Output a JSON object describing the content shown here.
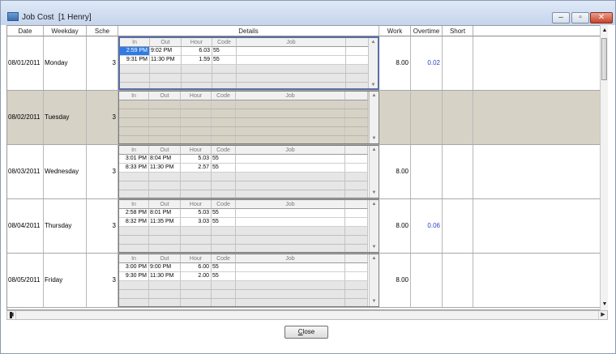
{
  "window": {
    "title": "Job Cost  [1 Henry]",
    "minimize_glyph": "–",
    "maximize_glyph": "▫",
    "close_glyph": "✕"
  },
  "columns": {
    "date": "Date",
    "weekday": "Weekday",
    "sche": "Sche",
    "details": "Details",
    "work": "Work",
    "overtime": "Overtime",
    "short": "Short"
  },
  "detail_columns": {
    "in": "In",
    "out": "Out",
    "hour": "Hour",
    "code": "Code",
    "job": "Job"
  },
  "rows": [
    {
      "date": "08/01/2011",
      "weekday": "Monday",
      "sche": "3",
      "work": "8.00",
      "overtime": "0.02",
      "short": "",
      "entries": [
        {
          "in": "2:59 PM",
          "out": "9:02 PM",
          "hour": "6.03",
          "code": "55",
          "job": ""
        },
        {
          "in": "9:31 PM",
          "out": "11:30 PM",
          "hour": "1.59",
          "code": "55",
          "job": ""
        }
      ]
    },
    {
      "date": "08/02/2011",
      "weekday": "Tuesday",
      "sche": "3",
      "work": "",
      "overtime": "",
      "short": "",
      "entries": []
    },
    {
      "date": "08/03/2011",
      "weekday": "Wednesday",
      "sche": "3",
      "work": "8.00",
      "overtime": "",
      "short": "",
      "entries": [
        {
          "in": "3:01 PM",
          "out": "8:04 PM",
          "hour": "5.03",
          "code": "55",
          "job": ""
        },
        {
          "in": "8:33 PM",
          "out": "11:30 PM",
          "hour": "2.57",
          "code": "55",
          "job": ""
        }
      ]
    },
    {
      "date": "08/04/2011",
      "weekday": "Thursday",
      "sche": "3",
      "work": "8.00",
      "overtime": "0.06",
      "short": "",
      "entries": [
        {
          "in": "2:58 PM",
          "out": "8:01 PM",
          "hour": "5.03",
          "code": "55",
          "job": ""
        },
        {
          "in": "8:32 PM",
          "out": "11:35 PM",
          "hour": "3.03",
          "code": "55",
          "job": ""
        }
      ]
    },
    {
      "date": "08/05/2011",
      "weekday": "Friday",
      "sche": "3",
      "work": "8.00",
      "overtime": "",
      "short": "",
      "entries": [
        {
          "in": "3:00 PM",
          "out": "9:00 PM",
          "hour": "6.00",
          "code": "55",
          "job": ""
        },
        {
          "in": "9:30 PM",
          "out": "11:30 PM",
          "hour": "2.00",
          "code": "55",
          "job": ""
        }
      ]
    }
  ],
  "buttons": {
    "close_accel": "C",
    "close_rest": "lose"
  },
  "colors": {
    "selected_cell": "#2f7be5",
    "overtime_text": "#2b3fc4",
    "shaded_row": "#d6d2c6"
  }
}
